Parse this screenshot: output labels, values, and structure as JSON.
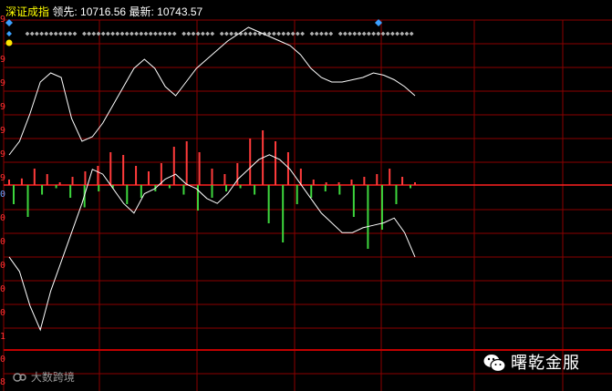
{
  "header": {
    "index_name": "深证成指",
    "lead_label": "领先:",
    "lead_value": "10716.56",
    "latest_label": "最新:",
    "latest_value": "10743.57"
  },
  "y_axis_labels": [
    "9",
    "9",
    "9",
    "9",
    "9",
    "9",
    "9",
    "0",
    "0",
    "0",
    "0",
    "0",
    "0",
    "1",
    "0",
    "8"
  ],
  "watermark": {
    "text": "大数跨境"
  },
  "brand": {
    "text": "曙乾金服"
  },
  "colors": {
    "background": "#000000",
    "grid": "#8b0000",
    "baseline": "#ff2020",
    "up_bar": "#ff3b3b",
    "down_bar": "#3dd63d",
    "price_line": "#ffffff",
    "lead_line": "#ffffff",
    "marker": "#3aa0ff",
    "marker_row": "#b0b0b0"
  },
  "chart_data": {
    "type": "line",
    "series": [
      {
        "values": [
          0.44,
          0.5,
          0.62,
          0.76,
          0.8,
          0.78,
          0.6,
          0.5,
          0.52,
          0.58,
          0.66,
          0.74,
          0.82,
          0.86,
          0.82,
          0.74,
          0.7,
          0.76,
          0.82,
          0.86,
          0.9,
          0.94,
          0.97,
          1.0,
          0.98,
          0.96,
          0.94,
          0.92,
          0.88,
          0.82,
          0.78,
          0.76,
          0.76,
          0.77,
          0.78,
          0.8,
          0.79,
          0.77,
          0.74,
          0.7
        ]
      },
      {
        "values": [
          0.3,
          0.24,
          0.1,
          0.0,
          0.16,
          0.28,
          0.4,
          0.52,
          0.66,
          0.64,
          0.58,
          0.52,
          0.48,
          0.56,
          0.58,
          0.62,
          0.64,
          0.6,
          0.58,
          0.54,
          0.52,
          0.56,
          0.62,
          0.66,
          0.7,
          0.72,
          0.7,
          0.66,
          0.6,
          0.54,
          0.48,
          0.44,
          0.4,
          0.4,
          0.42,
          0.43,
          0.44,
          0.46,
          0.4,
          0.3
        ]
      },
      {
        "values": [
          0.1,
          0.12,
          0.3,
          0.2,
          0.05,
          0.15,
          0.25,
          0.35,
          0.6,
          0.55,
          0.35,
          0.25,
          0.4,
          0.7,
          0.8,
          0.6,
          0.3,
          0.2,
          0.4,
          0.85,
          1.0,
          0.8,
          0.6,
          0.3,
          0.1,
          0.05,
          0.05,
          0.1,
          0.15,
          0.2,
          0.3,
          0.15,
          0.05
        ]
      },
      {
        "values": [
          -0.3,
          -0.5,
          -0.15,
          -0.05,
          -0.2,
          -0.35,
          -0.1,
          -0.05,
          -0.3,
          -0.2,
          -0.1,
          -0.05,
          -0.15,
          -0.4,
          -0.2,
          -0.1,
          -0.05,
          -0.15,
          -0.6,
          -0.9,
          -0.3,
          -0.2,
          -0.1,
          -0.15,
          -0.5,
          -1.0,
          -0.7,
          -0.3,
          -0.05
        ]
      }
    ]
  }
}
